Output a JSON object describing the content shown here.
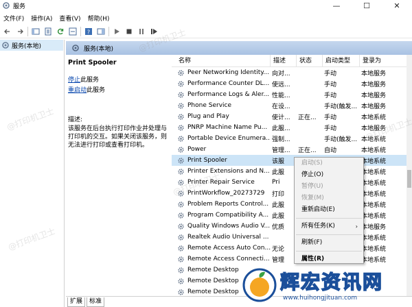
{
  "window": {
    "title": "服务"
  },
  "menu": [
    "文件(F)",
    "操作(A)",
    "查看(V)",
    "帮助(H)"
  ],
  "tree": {
    "root": "服务(本地)"
  },
  "header": {
    "title": "服务(本地)"
  },
  "description": {
    "service_name": "Print Spooler",
    "stop_link": "停止",
    "stop_suffix": "此服务",
    "restart_link": "重启动",
    "restart_suffix": "此服务",
    "label": "描述:",
    "text": "该服务在后台执行打印作业并处理与打印机的交互。如果关闭该服务，则无法进行打印或查看打印机。"
  },
  "table": {
    "columns": [
      "名称",
      "描述",
      "状态",
      "启动类型",
      "登录为"
    ],
    "rows": [
      {
        "name": "Peer Networking Identity...",
        "desc": "向对...",
        "status": "",
        "start": "手动",
        "logon": "本地服务"
      },
      {
        "name": "Performance Counter DL...",
        "desc": "使远...",
        "status": "",
        "start": "手动",
        "logon": "本地服务"
      },
      {
        "name": "Performance Logs & Aler...",
        "desc": "性能...",
        "status": "",
        "start": "手动",
        "logon": "本地服务"
      },
      {
        "name": "Phone Service",
        "desc": "在设...",
        "status": "",
        "start": "手动(触发...",
        "logon": "本地服务"
      },
      {
        "name": "Plug and Play",
        "desc": "使计...",
        "status": "正在...",
        "start": "手动",
        "logon": "本地系统"
      },
      {
        "name": "PNRP Machine Name Pu...",
        "desc": "此服...",
        "status": "",
        "start": "手动",
        "logon": "本地服务"
      },
      {
        "name": "Portable Device Enumera...",
        "desc": "强制...",
        "status": "",
        "start": "手动(触发...",
        "logon": "本地系统"
      },
      {
        "name": "Power",
        "desc": "管理...",
        "status": "正在...",
        "start": "自动",
        "logon": "本地系统"
      },
      {
        "name": "Print Spooler",
        "desc": "该服",
        "status": "",
        "start": "",
        "logon": "本地系统",
        "selected": true
      },
      {
        "name": "Printer Extensions and N...",
        "desc": "此服",
        "status": "",
        "start": "",
        "logon": "本地系统"
      },
      {
        "name": "Printer Repair Service",
        "desc": "Pri",
        "status": "",
        "start": "",
        "logon": "本地系统"
      },
      {
        "name": "PrintWorkflow_20273729",
        "desc": "打印",
        "status": "",
        "start": "",
        "logon": "本地系统"
      },
      {
        "name": "Problem Reports Control...",
        "desc": "此服",
        "status": "",
        "start": "",
        "logon": "本地系统"
      },
      {
        "name": "Program Compatibility A...",
        "desc": "此服",
        "status": "",
        "start": "",
        "logon": "本地系统"
      },
      {
        "name": "Quality Windows Audio V...",
        "desc": "优质",
        "status": "",
        "start": "",
        "logon": "本地服务"
      },
      {
        "name": "Realtek Audio Universal ...",
        "desc": "",
        "status": "",
        "start": "",
        "logon": "本地系统"
      },
      {
        "name": "Remote Access Auto Con...",
        "desc": "无论",
        "status": "",
        "start": "",
        "logon": "本地系统"
      },
      {
        "name": "Remote Access Connecti...",
        "desc": "管理",
        "status": "",
        "start": "",
        "logon": "本地系统"
      },
      {
        "name": "Remote Desktop",
        "desc": "",
        "status": "",
        "start": "",
        "logon": ""
      },
      {
        "name": "Remote Desktop",
        "desc": "",
        "status": "",
        "start": "",
        "logon": ""
      },
      {
        "name": "Remote Desktop",
        "desc": "",
        "status": "",
        "start": "",
        "logon": ""
      }
    ]
  },
  "context_menu": {
    "items": [
      {
        "label": "启动(S)",
        "disabled": true
      },
      {
        "label": "停止(O)",
        "disabled": false
      },
      {
        "label": "暂停(U)",
        "disabled": true
      },
      {
        "label": "恢复(M)",
        "disabled": true
      },
      {
        "label": "重新启动(E)",
        "disabled": false
      },
      {
        "sep": true
      },
      {
        "label": "所有任务(K)",
        "disabled": false,
        "submenu": true
      },
      {
        "sep": true
      },
      {
        "label": "刷新(F)",
        "disabled": false
      },
      {
        "sep": true
      },
      {
        "label": "属性(R)",
        "disabled": false,
        "bold": true
      }
    ]
  },
  "bottom_tabs": [
    "扩展",
    "标准"
  ],
  "watermark": "@打印机卫士",
  "logo": {
    "text": "辉宏资讯网",
    "url": "www.huihongjituan.com"
  },
  "colors": {
    "selection": "#cce4f7",
    "header_band": "#b4cae8",
    "link": "#0645ad",
    "logo_blue": "#1b4f9a"
  }
}
